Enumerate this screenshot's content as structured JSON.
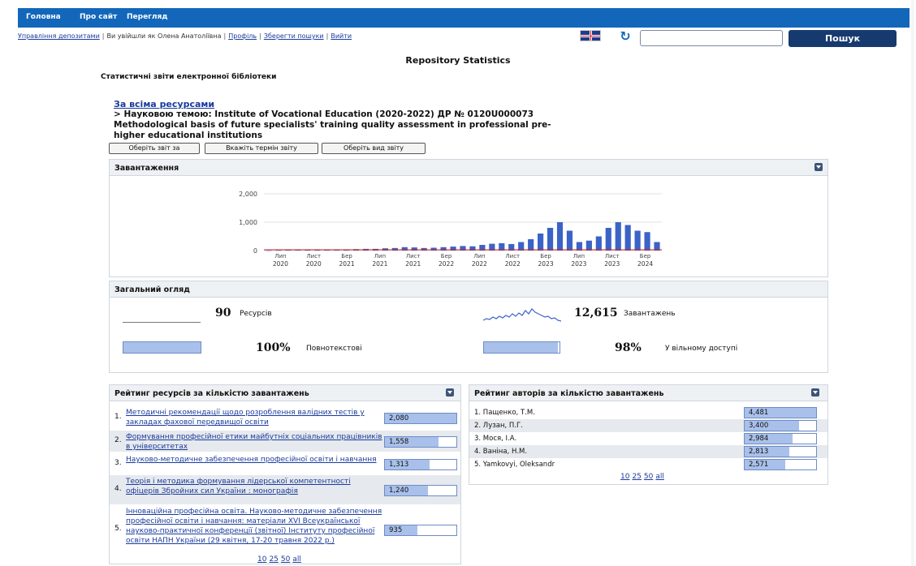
{
  "nav": {
    "items": [
      "Головна",
      "Про сайт",
      "Перегляд"
    ]
  },
  "userbar": {
    "deposits": "Управління депозитами",
    "logged_in": "Ви увійшли як Олена Анатоліївна",
    "profile": "Профіль",
    "saved_searches": "Зберегти пошуки",
    "logout": "Вийти",
    "separator": "|"
  },
  "search": {
    "placeholder": "",
    "button": "Пошук"
  },
  "page": {
    "title": "Repository Statistics",
    "subtitle": "Статистичні звіти електронної бібліотеки"
  },
  "breadcrumb": {
    "all": "За всіма ресурсами",
    "topic": "> Науковою темою: Institute of Vocational Education (2020-2022) ДР № 0120U000073 Methodological basis of future specialists' training quality assessment in professional pre-higher educational institutions"
  },
  "filters": [
    "Оберіть звіт за",
    "Вкажіть термін звіту",
    "Оберіть вид звіту"
  ],
  "downloads_panel": {
    "title": "Завантаження"
  },
  "chart_data": {
    "type": "bar",
    "x_ticks": [
      [
        "Лип",
        "2020"
      ],
      [
        "Лист",
        "2020"
      ],
      [
        "Бер",
        "2021"
      ],
      [
        "Лип",
        "2021"
      ],
      [
        "Лист",
        "2021"
      ],
      [
        "Бер",
        "2022"
      ],
      [
        "Лип",
        "2022"
      ],
      [
        "Лист",
        "2022"
      ],
      [
        "Бер",
        "2023"
      ],
      [
        "Лип",
        "2023"
      ],
      [
        "Лист",
        "2023"
      ],
      [
        "Бер",
        "2024"
      ]
    ],
    "y_ticks": [
      "2,000",
      "1,000",
      "0"
    ],
    "ylim": [
      0,
      2000
    ],
    "values": [
      5,
      10,
      15,
      20,
      15,
      20,
      30,
      40,
      35,
      50,
      60,
      60,
      80,
      90,
      120,
      110,
      90,
      100,
      120,
      140,
      160,
      150,
      200,
      240,
      260,
      230,
      300,
      400,
      600,
      800,
      1000,
      700,
      300,
      350,
      500,
      800,
      1000,
      900,
      700,
      650,
      300
    ],
    "bar_color": "#3b63c7",
    "line_color": "#cc2222",
    "grid": true
  },
  "overview": {
    "title": "Загальний огляд",
    "resources_num": "90",
    "resources_label": "Ресурсів",
    "downloads_num": "12,615",
    "downloads_label": "Завантажень",
    "fulltext_num": "100%",
    "fulltext_label": "Повнотекстові",
    "open_num": "98%",
    "open_label": "У вільному доступі",
    "fulltext_fraction": 1.0,
    "open_fraction": 0.98
  },
  "resources_ranking": {
    "title": "Рейтинг ресурсів за кількістю завантажень",
    "rows": [
      {
        "rank": "1.",
        "title": "Методичні рекомендації щодо розроблення валідних тестів у закладах фахової передвищої освіти",
        "value": "2,080",
        "fraction": 1.0
      },
      {
        "rank": "2.",
        "title": "Формування професійної етики майбутніх соціальних працівників в університетах",
        "value": "1,558",
        "fraction": 0.75
      },
      {
        "rank": "3.",
        "title": "Науково-методичне забезпечення професійної освіти і навчання",
        "value": "1,313",
        "fraction": 0.63
      },
      {
        "rank": "4.",
        "title": "Теорія і методика формування лідерської компетентності офіцерів Збройних сил України : монографія",
        "value": "1,240",
        "fraction": 0.6
      },
      {
        "rank": "5.",
        "title": "Інноваційна професійна освіта. Науково-методичне забезпечення професійної освіти і навчання: матеріали XVI Всеукраїнської науково-практичної конференції (звітної) Інституту професійної освіти НАПН України (29 квітня, 17-20 травня 2022 р.)",
        "value": "935",
        "fraction": 0.45
      }
    ],
    "pager": [
      "10",
      "25",
      "50",
      "all"
    ]
  },
  "authors_ranking": {
    "title": "Рейтинг авторів за кількістю завантажень",
    "rows": [
      {
        "name": "1. Пащенко, Т.М.",
        "value": "4,481",
        "fraction": 1.0
      },
      {
        "name": "2. Лузан, П.Г.",
        "value": "3,400",
        "fraction": 0.76
      },
      {
        "name": "3. Мося, І.А.",
        "value": "2,984",
        "fraction": 0.67
      },
      {
        "name": "4. Ваніна, Н.М.",
        "value": "2,813",
        "fraction": 0.63
      },
      {
        "name": "5. Yamkovyi, Oleksandr",
        "value": "2,571",
        "fraction": 0.57
      }
    ],
    "pager": [
      "10",
      "25",
      "50",
      "all"
    ]
  }
}
